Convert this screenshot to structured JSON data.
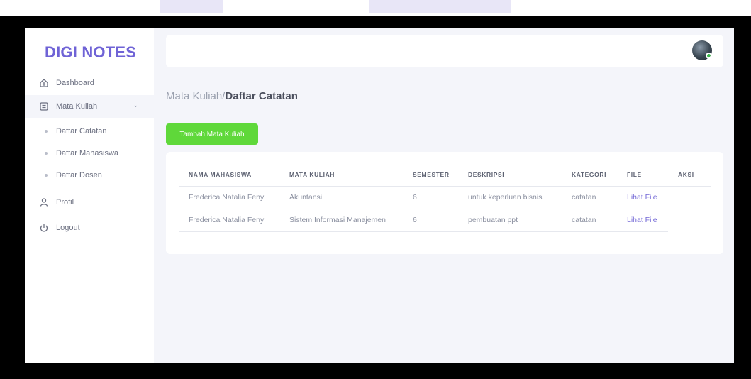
{
  "brand": {
    "name": "DIGI NOTES",
    "color": "#6f63d6"
  },
  "sidebar": {
    "items": [
      {
        "label": "Dashboard",
        "icon": "home-icon"
      },
      {
        "label": "Mata Kuliah",
        "icon": "notes-icon"
      },
      {
        "label": "Profil",
        "icon": "user-icon"
      },
      {
        "label": "Logout",
        "icon": "power-icon"
      }
    ],
    "subitems": [
      "Daftar Catatan",
      "Daftar Mahasiswa",
      "Daftar Dosen"
    ]
  },
  "breadcrumb": {
    "parent": "Mata Kuliah/",
    "current": "Daftar Catatan"
  },
  "add_button": {
    "label": "Tambah Mata Kuliah",
    "color": "#5fd83a"
  },
  "table": {
    "headers": [
      "NAMA MAHASISWA",
      "MATA KULIAH",
      "SEMESTER",
      "DESKRIPSI",
      "KATEGORI",
      "FILE",
      "AKSI"
    ],
    "rows": [
      [
        "Frederica Natalia Feny",
        "Akuntansi",
        "6",
        "untuk keperluan bisnis",
        "catatan",
        "Lihat File",
        ""
      ],
      [
        "Frederica Natalia Feny",
        "Sistem Informasi Manajemen",
        "6",
        "pembuatan ppt",
        "catatan",
        "Lihat File",
        ""
      ]
    ]
  }
}
